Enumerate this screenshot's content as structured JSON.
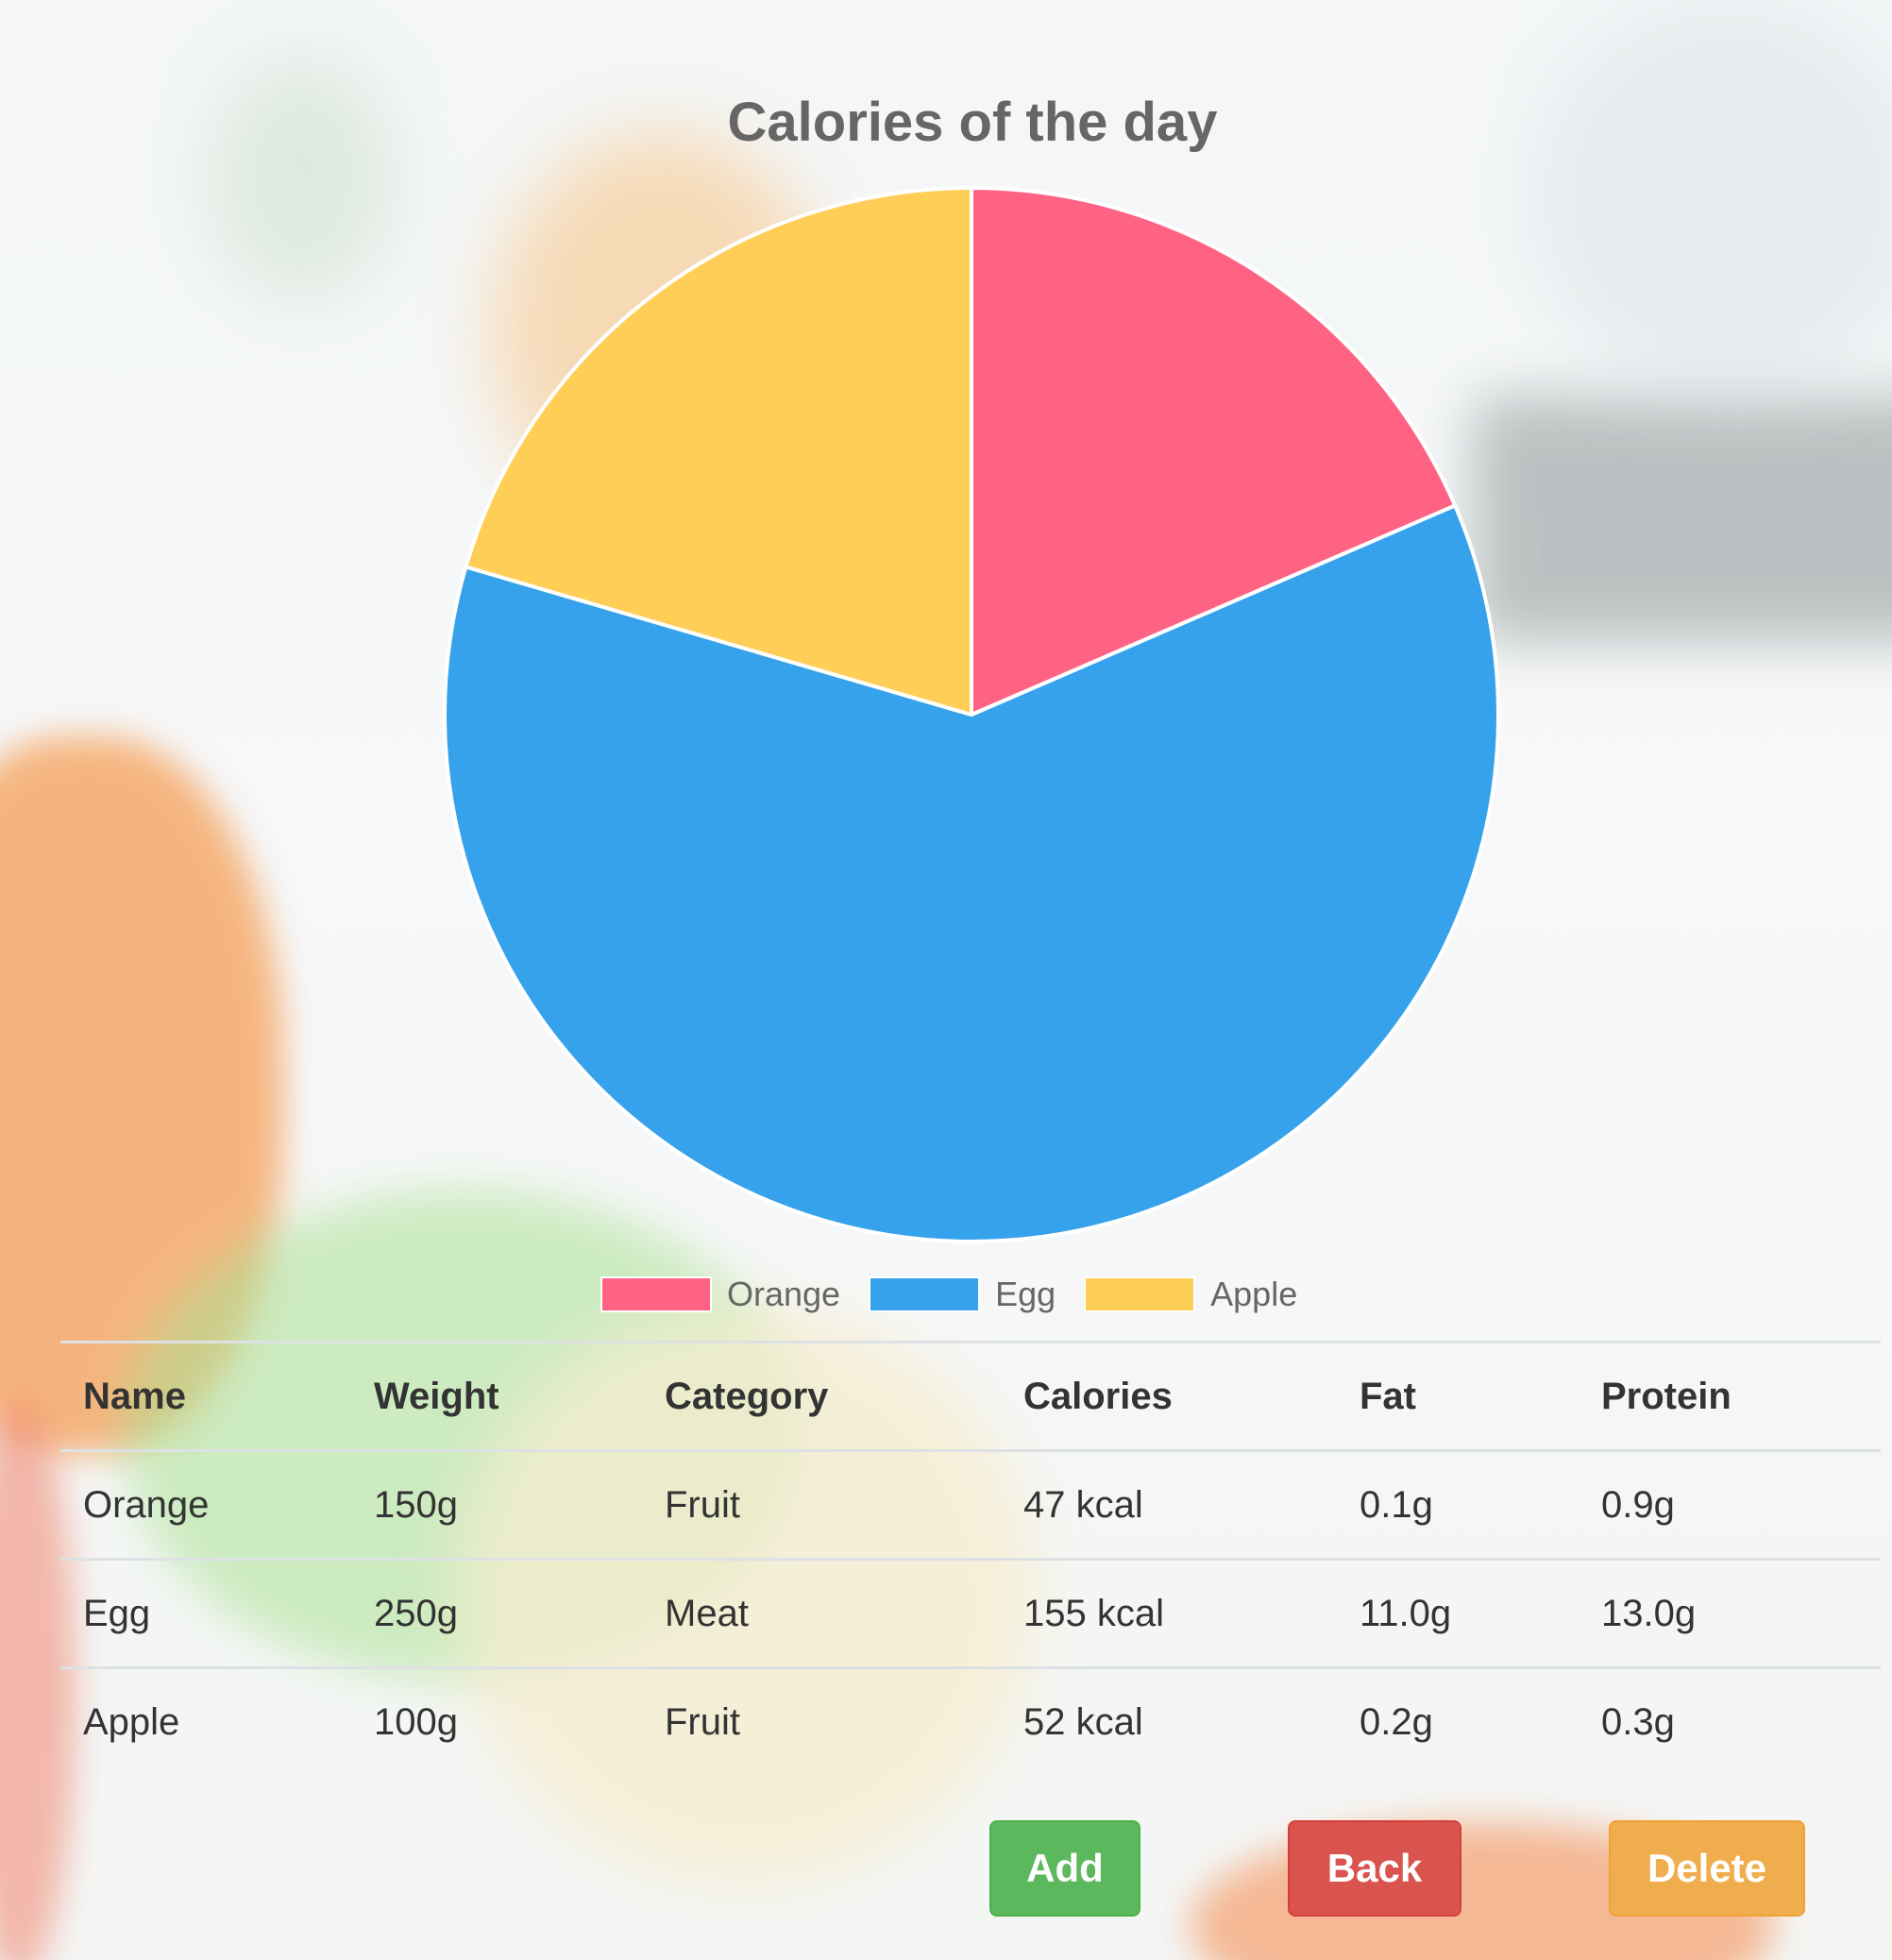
{
  "chart_data": {
    "type": "pie",
    "title": "Calories of the day",
    "categories": [
      "Orange",
      "Egg",
      "Apple"
    ],
    "values": [
      47,
      155,
      52
    ],
    "colors": [
      "#ff6384",
      "#36a2eb",
      "#ffce56"
    ],
    "legend_position": "bottom"
  },
  "table": {
    "headers": [
      "Name",
      "Weight",
      "Category",
      "Calories",
      "Fat",
      "Protein"
    ],
    "rows": [
      [
        "Orange",
        "150g",
        "Fruit",
        "47 kcal",
        "0.1g",
        "0.9g"
      ],
      [
        "Egg",
        "250g",
        "Meat",
        "155 kcal",
        "11.0g",
        "13.0g"
      ],
      [
        "Apple",
        "100g",
        "Fruit",
        "52 kcal",
        "0.2g",
        "0.3g"
      ]
    ]
  },
  "buttons": {
    "add": "Add",
    "back": "Back",
    "delete": "Delete"
  }
}
